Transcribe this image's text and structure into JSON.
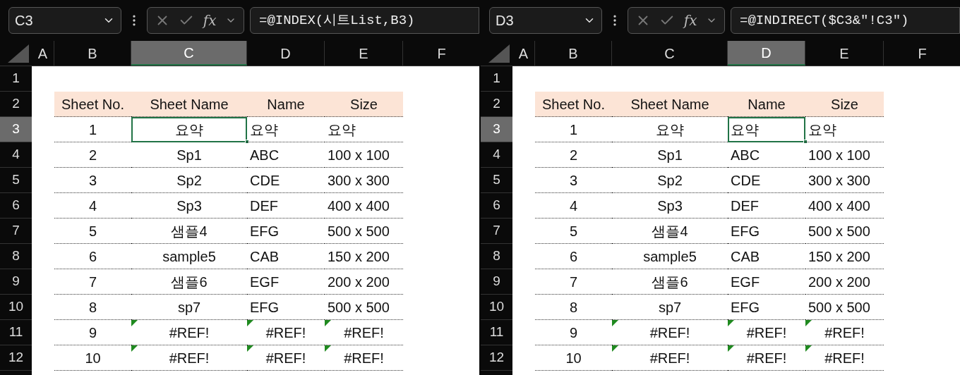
{
  "panes": [
    {
      "name_box": "C3",
      "fx_label": "fx",
      "formula": "=@INDEX(시트List,B3)",
      "column_headers": [
        {
          "label": "A",
          "selected": false
        },
        {
          "label": "B",
          "selected": false
        },
        {
          "label": "C",
          "selected": true
        },
        {
          "label": "D",
          "selected": false
        },
        {
          "label": "E",
          "selected": false
        },
        {
          "label": "F",
          "selected": false
        }
      ],
      "row_headers": [
        {
          "label": "1",
          "selected": false
        },
        {
          "label": "2",
          "selected": false
        },
        {
          "label": "3",
          "selected": true
        },
        {
          "label": "4",
          "selected": false
        },
        {
          "label": "5",
          "selected": false
        },
        {
          "label": "6",
          "selected": false
        },
        {
          "label": "7",
          "selected": false
        },
        {
          "label": "8",
          "selected": false
        },
        {
          "label": "9",
          "selected": false
        },
        {
          "label": "10",
          "selected": false
        },
        {
          "label": "11",
          "selected": false
        },
        {
          "label": "12",
          "selected": false
        }
      ],
      "table": {
        "columns": [
          "Sheet No.",
          "Sheet Name",
          "Name",
          "Size"
        ],
        "rows": [
          {
            "cells": [
              {
                "text": "1",
                "selected": false,
                "error": false
              },
              {
                "text": "요약",
                "selected": true,
                "error": false
              },
              {
                "text": "요약",
                "selected": false,
                "error": false
              },
              {
                "text": "요약",
                "selected": false,
                "error": false
              }
            ]
          },
          {
            "cells": [
              {
                "text": "2",
                "selected": false,
                "error": false
              },
              {
                "text": "Sp1",
                "selected": false,
                "error": false
              },
              {
                "text": "ABC",
                "selected": false,
                "error": false
              },
              {
                "text": "100 x 100",
                "selected": false,
                "error": false
              }
            ]
          },
          {
            "cells": [
              {
                "text": "3",
                "selected": false,
                "error": false
              },
              {
                "text": "Sp2",
                "selected": false,
                "error": false
              },
              {
                "text": "CDE",
                "selected": false,
                "error": false
              },
              {
                "text": "300 x 300",
                "selected": false,
                "error": false
              }
            ]
          },
          {
            "cells": [
              {
                "text": "4",
                "selected": false,
                "error": false
              },
              {
                "text": "Sp3",
                "selected": false,
                "error": false
              },
              {
                "text": "DEF",
                "selected": false,
                "error": false
              },
              {
                "text": "400 x 400",
                "selected": false,
                "error": false
              }
            ]
          },
          {
            "cells": [
              {
                "text": "5",
                "selected": false,
                "error": false
              },
              {
                "text": "샘플4",
                "selected": false,
                "error": false
              },
              {
                "text": "EFG",
                "selected": false,
                "error": false
              },
              {
                "text": "500 x 500",
                "selected": false,
                "error": false
              }
            ]
          },
          {
            "cells": [
              {
                "text": "6",
                "selected": false,
                "error": false
              },
              {
                "text": "sample5",
                "selected": false,
                "error": false
              },
              {
                "text": "CAB",
                "selected": false,
                "error": false
              },
              {
                "text": "150 x 200",
                "selected": false,
                "error": false
              }
            ]
          },
          {
            "cells": [
              {
                "text": "7",
                "selected": false,
                "error": false
              },
              {
                "text": "샘플6",
                "selected": false,
                "error": false
              },
              {
                "text": "EGF",
                "selected": false,
                "error": false
              },
              {
                "text": "200 x 200",
                "selected": false,
                "error": false
              }
            ]
          },
          {
            "cells": [
              {
                "text": "8",
                "selected": false,
                "error": false
              },
              {
                "text": "sp7",
                "selected": false,
                "error": false
              },
              {
                "text": "EFG",
                "selected": false,
                "error": false
              },
              {
                "text": "500 x 500",
                "selected": false,
                "error": false
              }
            ]
          },
          {
            "cells": [
              {
                "text": "9",
                "selected": false,
                "error": false
              },
              {
                "text": "#REF!",
                "selected": false,
                "error": true
              },
              {
                "text": "#REF!",
                "selected": false,
                "error": true
              },
              {
                "text": "#REF!",
                "selected": false,
                "error": true
              }
            ]
          },
          {
            "cells": [
              {
                "text": "10",
                "selected": false,
                "error": false
              },
              {
                "text": "#REF!",
                "selected": false,
                "error": true
              },
              {
                "text": "#REF!",
                "selected": false,
                "error": true
              },
              {
                "text": "#REF!",
                "selected": false,
                "error": true
              }
            ]
          }
        ]
      }
    },
    {
      "name_box": "D3",
      "fx_label": "fx",
      "formula": "=@INDIRECT($C3&\"!C3\")",
      "column_headers": [
        {
          "label": "A",
          "selected": false
        },
        {
          "label": "B",
          "selected": false
        },
        {
          "label": "C",
          "selected": false
        },
        {
          "label": "D",
          "selected": true
        },
        {
          "label": "E",
          "selected": false
        },
        {
          "label": "F",
          "selected": false
        }
      ],
      "row_headers": [
        {
          "label": "1",
          "selected": false
        },
        {
          "label": "2",
          "selected": false
        },
        {
          "label": "3",
          "selected": true
        },
        {
          "label": "4",
          "selected": false
        },
        {
          "label": "5",
          "selected": false
        },
        {
          "label": "6",
          "selected": false
        },
        {
          "label": "7",
          "selected": false
        },
        {
          "label": "8",
          "selected": false
        },
        {
          "label": "9",
          "selected": false
        },
        {
          "label": "10",
          "selected": false
        },
        {
          "label": "11",
          "selected": false
        },
        {
          "label": "12",
          "selected": false
        }
      ],
      "table": {
        "columns": [
          "Sheet No.",
          "Sheet Name",
          "Name",
          "Size"
        ],
        "rows": [
          {
            "cells": [
              {
                "text": "1",
                "selected": false,
                "error": false
              },
              {
                "text": "요약",
                "selected": false,
                "error": false
              },
              {
                "text": "요약",
                "selected": true,
                "error": false
              },
              {
                "text": "요약",
                "selected": false,
                "error": false
              }
            ]
          },
          {
            "cells": [
              {
                "text": "2",
                "selected": false,
                "error": false
              },
              {
                "text": "Sp1",
                "selected": false,
                "error": false
              },
              {
                "text": "ABC",
                "selected": false,
                "error": false
              },
              {
                "text": "100 x 100",
                "selected": false,
                "error": false
              }
            ]
          },
          {
            "cells": [
              {
                "text": "3",
                "selected": false,
                "error": false
              },
              {
                "text": "Sp2",
                "selected": false,
                "error": false
              },
              {
                "text": "CDE",
                "selected": false,
                "error": false
              },
              {
                "text": "300 x 300",
                "selected": false,
                "error": false
              }
            ]
          },
          {
            "cells": [
              {
                "text": "4",
                "selected": false,
                "error": false
              },
              {
                "text": "Sp3",
                "selected": false,
                "error": false
              },
              {
                "text": "DEF",
                "selected": false,
                "error": false
              },
              {
                "text": "400 x 400",
                "selected": false,
                "error": false
              }
            ]
          },
          {
            "cells": [
              {
                "text": "5",
                "selected": false,
                "error": false
              },
              {
                "text": "샘플4",
                "selected": false,
                "error": false
              },
              {
                "text": "EFG",
                "selected": false,
                "error": false
              },
              {
                "text": "500 x 500",
                "selected": false,
                "error": false
              }
            ]
          },
          {
            "cells": [
              {
                "text": "6",
                "selected": false,
                "error": false
              },
              {
                "text": "sample5",
                "selected": false,
                "error": false
              },
              {
                "text": "CAB",
                "selected": false,
                "error": false
              },
              {
                "text": "150 x 200",
                "selected": false,
                "error": false
              }
            ]
          },
          {
            "cells": [
              {
                "text": "7",
                "selected": false,
                "error": false
              },
              {
                "text": "샘플6",
                "selected": false,
                "error": false
              },
              {
                "text": "EGF",
                "selected": false,
                "error": false
              },
              {
                "text": "200 x 200",
                "selected": false,
                "error": false
              }
            ]
          },
          {
            "cells": [
              {
                "text": "8",
                "selected": false,
                "error": false
              },
              {
                "text": "sp7",
                "selected": false,
                "error": false
              },
              {
                "text": "EFG",
                "selected": false,
                "error": false
              },
              {
                "text": "500 x 500",
                "selected": false,
                "error": false
              }
            ]
          },
          {
            "cells": [
              {
                "text": "9",
                "selected": false,
                "error": false
              },
              {
                "text": "#REF!",
                "selected": false,
                "error": true
              },
              {
                "text": "#REF!",
                "selected": false,
                "error": true
              },
              {
                "text": "#REF!",
                "selected": false,
                "error": true
              }
            ]
          },
          {
            "cells": [
              {
                "text": "10",
                "selected": false,
                "error": false
              },
              {
                "text": "#REF!",
                "selected": false,
                "error": true
              },
              {
                "text": "#REF!",
                "selected": false,
                "error": true
              },
              {
                "text": "#REF!",
                "selected": false,
                "error": true
              }
            ]
          }
        ]
      }
    }
  ]
}
